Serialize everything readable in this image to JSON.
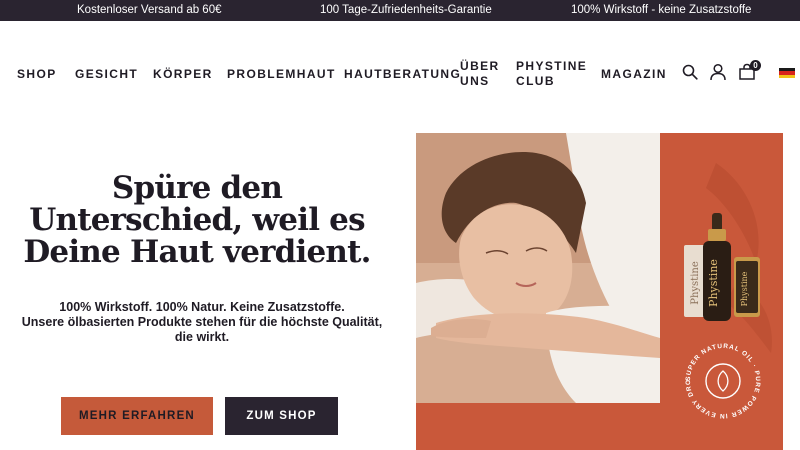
{
  "topbar": {
    "items": [
      "Kostenloser Versand ab 60€",
      "100 Tage-Zufriedenheits-Garantie",
      "100% Wirkstoff - keine Zusatzstoffe"
    ]
  },
  "nav": {
    "items": [
      "SHOP",
      "GESICHT",
      "KÖRPER",
      "PROBLEMHAUT",
      "HAUTBERATUNG",
      "ÜBER UNS",
      "PHYSTINE CLUB",
      "MAGAZIN"
    ],
    "cart_count": "0",
    "icons": [
      "search-icon",
      "user-icon",
      "cart-icon",
      "german-flag-icon"
    ]
  },
  "hero": {
    "headline": "Spüre den Unterschied, weil es Deine Haut verdient.",
    "subline_1": "100% Wirkstoff. 100% Natur. Keine Zusatzstoffe.",
    "subline_2": "Unsere ölbasierten Produkte stehen für die höchste Qualität, die wirkt.",
    "cta_primary": "MEHR ERFAHREN",
    "cta_secondary": "ZUM SHOP",
    "bottle_brand": "Phystine",
    "seal_text": "SUPER NATURAL OIL · PURE POWER IN EVERY DROP ·"
  },
  "colors": {
    "dark": "#2a2430",
    "accent": "#c55a3a",
    "hero_bg": "#c9583a"
  }
}
